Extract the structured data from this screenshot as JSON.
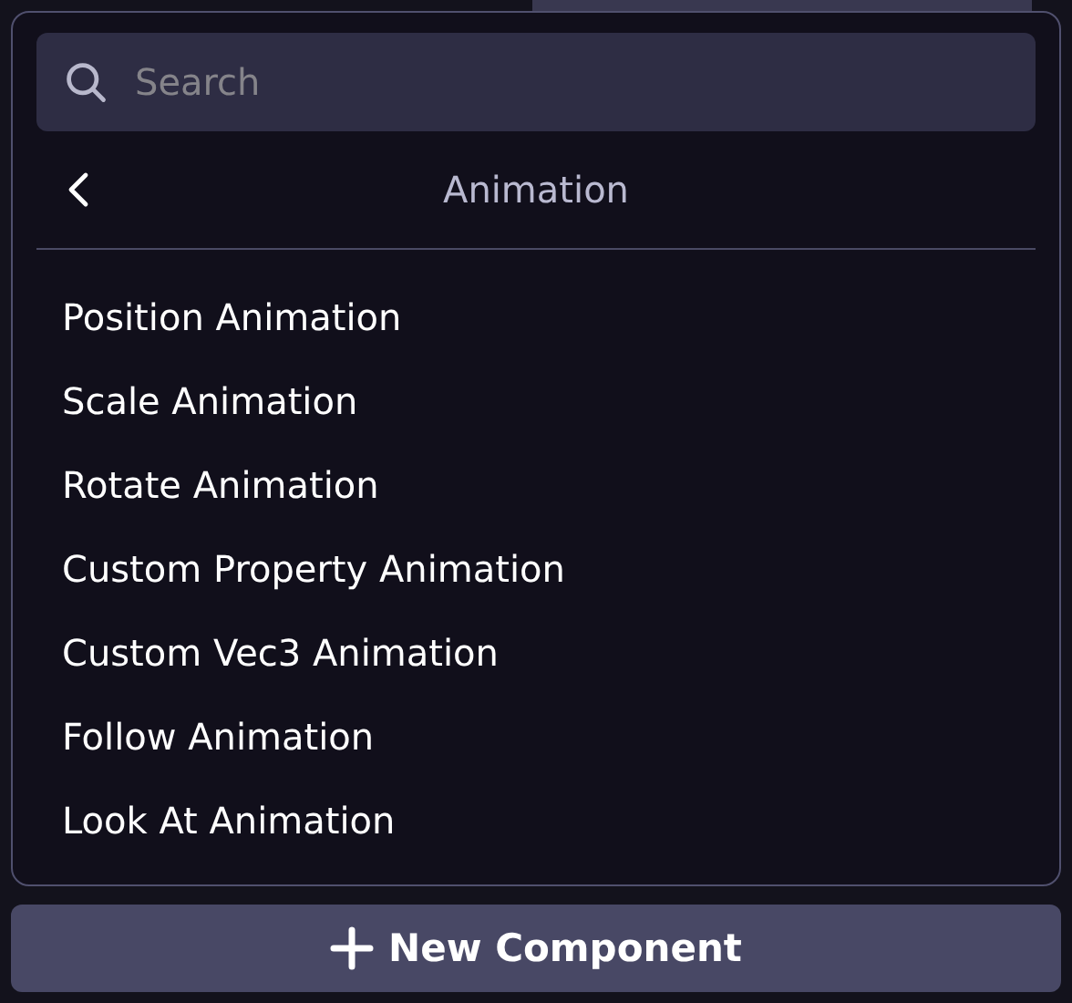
{
  "search": {
    "placeholder": "Search"
  },
  "header": {
    "title": "Animation"
  },
  "items": [
    {
      "label": "Position Animation"
    },
    {
      "label": "Scale Animation"
    },
    {
      "label": "Rotate Animation"
    },
    {
      "label": "Custom Property Animation"
    },
    {
      "label": "Custom Vec3 Animation"
    },
    {
      "label": "Follow Animation"
    },
    {
      "label": "Look At Animation"
    }
  ],
  "button": {
    "label": "New Component"
  }
}
